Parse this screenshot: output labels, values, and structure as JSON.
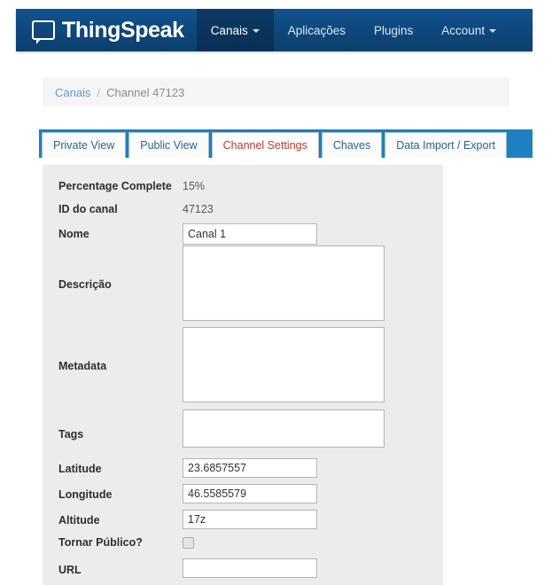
{
  "navbar": {
    "brand": "ThingSpeak",
    "brand_icon": "speech-bubble-icon",
    "items": [
      {
        "label": "Canais",
        "has_caret": true,
        "active": true
      },
      {
        "label": "Aplicações",
        "has_caret": false,
        "active": false
      },
      {
        "label": "Plugins",
        "has_caret": false,
        "active": false
      },
      {
        "label": "Account",
        "has_caret": true,
        "active": false
      }
    ],
    "bg_color": "#0e4a80"
  },
  "breadcrumb": {
    "root": "Canais",
    "separator": "/",
    "current": "Channel 47123"
  },
  "tabs": [
    {
      "label": "Private View",
      "active": false
    },
    {
      "label": "Public View",
      "active": false
    },
    {
      "label": "Channel Settings",
      "active": true
    },
    {
      "label": "Chaves",
      "active": false
    },
    {
      "label": "Data Import / Export",
      "active": false
    }
  ],
  "tabs_accent_color": "#1e7fc1",
  "active_tab_color": "#c0392b",
  "form": {
    "percentage_complete_label": "Percentage Complete",
    "percentage_complete_value": "15%",
    "channel_id_label": "ID do canal",
    "channel_id_value": "47123",
    "name_label": "Nome",
    "name_value": "Canal 1",
    "description_label": "Descrição",
    "description_value": "",
    "metadata_label": "Metadata",
    "metadata_value": "",
    "tags_label": "Tags",
    "tags_value": "",
    "latitude_label": "Latitude",
    "latitude_value": "23.6857557",
    "longitude_label": "Longitude",
    "longitude_value": "46.5585579",
    "altitude_label": "Altitude",
    "altitude_value": "17z",
    "make_public_label": "Tornar Público?",
    "make_public_checked": false,
    "url_label": "URL",
    "url_value": ""
  }
}
